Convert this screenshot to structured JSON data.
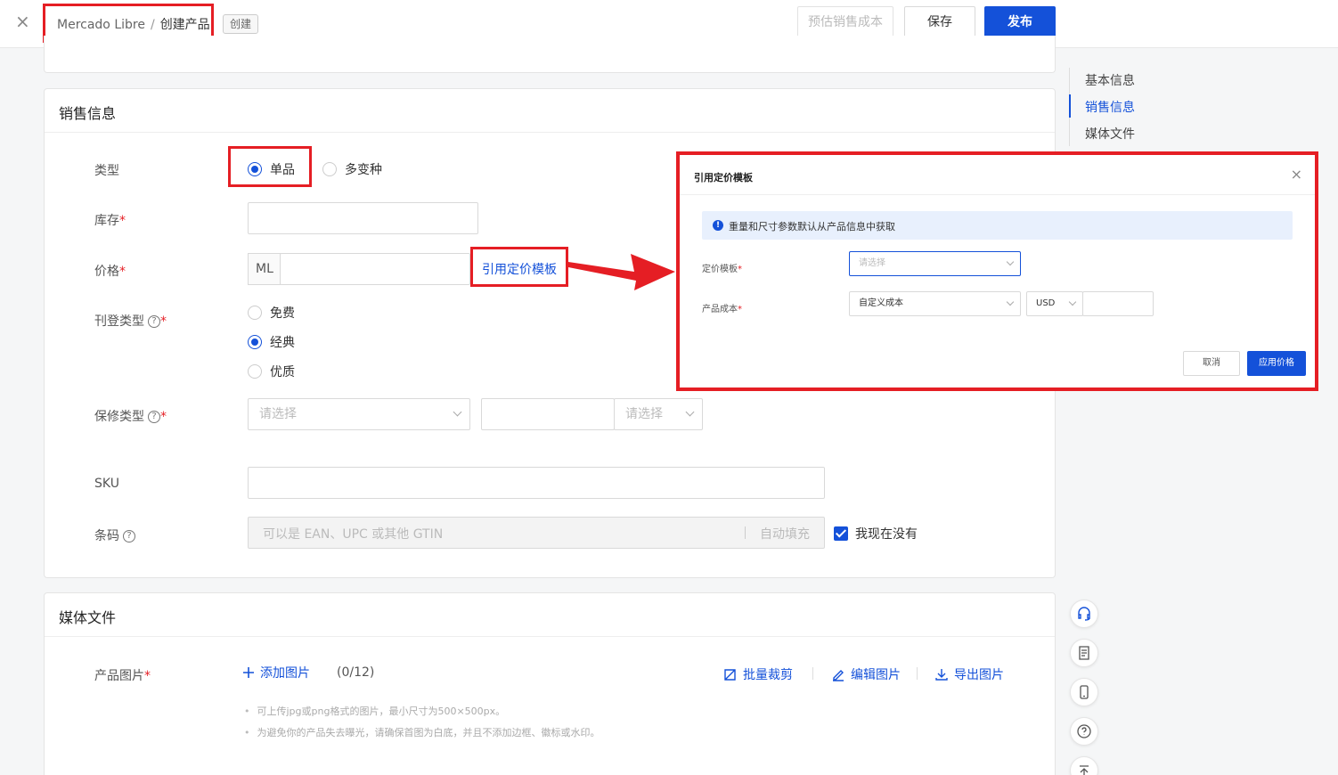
{
  "topbar": {
    "close_label": "×",
    "breadcrumb_root": "Mercado Libre",
    "breadcrumb_sep": "/",
    "breadcrumb_current": "创建产品",
    "badge": "创建",
    "estimate_label": "预估销售成本",
    "save_label": "保存",
    "publish_label": "发布"
  },
  "sales": {
    "title": "销售信息",
    "type_label": "类型",
    "type_options": [
      "单品",
      "多变种"
    ],
    "type_selected": "单品",
    "stock_label": "库存",
    "stock_value": "",
    "price_label": "价格",
    "price_prefix": "ML",
    "price_value": "",
    "pricing_template_link": "引用定价模板",
    "listing_type_label": "刊登类型",
    "listing_options": [
      "免费",
      "经典",
      "优质"
    ],
    "listing_selected": "经典",
    "warranty_label": "保修类型",
    "warranty_select1_placeholder": "请选择",
    "warranty_input_value": "",
    "warranty_select2_placeholder": "请选择",
    "sku_label": "SKU",
    "sku_value": "",
    "barcode_label": "条码",
    "barcode_placeholder": "可以是 EAN、UPC 或其他 GTIN",
    "barcode_autofill": "自动填充",
    "no_barcode_label": "我现在没有",
    "no_barcode_checked": true,
    "required_mark": "*",
    "help_mark": "?"
  },
  "media": {
    "title": "媒体文件",
    "product_images_label": "产品图片",
    "add_image": "添加图片",
    "count": "(0/12)",
    "batch_crop": "批量裁剪",
    "edit_images": "编辑图片",
    "export_images": "导出图片",
    "hint1": "可上传jpg或png格式的图片，最小尺寸为500×500px。",
    "hint2": "为避免你的产品失去曝光，请确保首图为白底，并且不添加边框、徽标或水印。"
  },
  "right_nav": {
    "items": [
      "基本信息",
      "销售信息",
      "媒体文件"
    ],
    "active": "销售信息"
  },
  "modal": {
    "title": "引用定价模板",
    "close": "×",
    "info_icon": "!",
    "alert": "重量和尺寸参数默认从产品信息中获取",
    "template_label": "定价模板",
    "template_placeholder": "请选择",
    "cost_label": "产品成本",
    "cost_type": "自定义成本",
    "currency": "USD",
    "cost_value": "",
    "cancel": "取消",
    "apply": "应用价格"
  },
  "colors": {
    "primary": "#1451d9",
    "annotation_red": "#e51e24"
  }
}
